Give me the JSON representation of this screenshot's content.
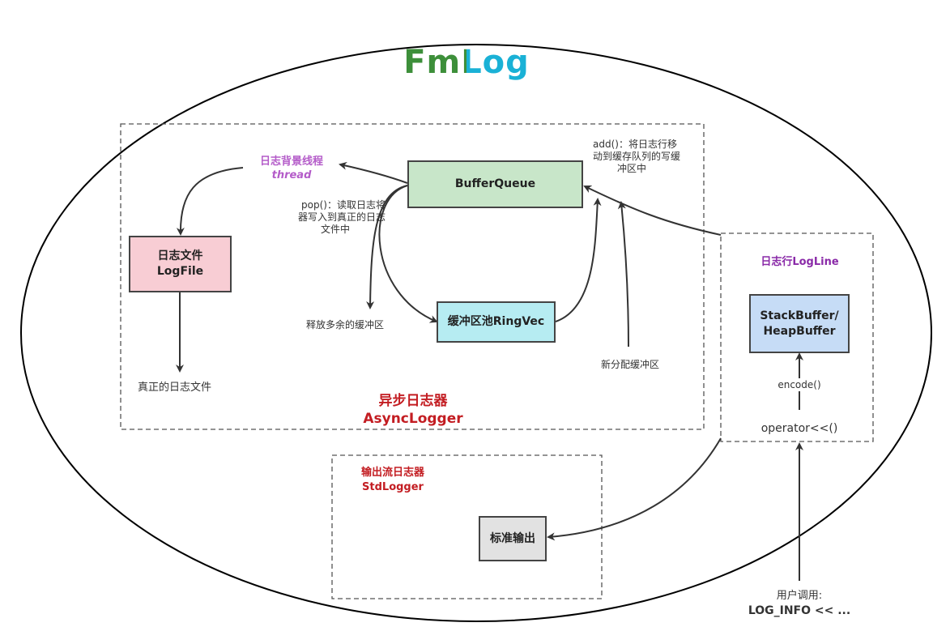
{
  "title": "FmLog",
  "title_colors": {
    "fm": "#3d8f3a",
    "log": "#1ab1d6"
  },
  "async_logger": {
    "label_cn": "异步日志器",
    "label_en": "AsyncLogger",
    "color": "#c31d22"
  },
  "std_logger": {
    "label_cn": "输出流日志器",
    "label_en": "StdLogger",
    "color": "#c31d22"
  },
  "log_line": {
    "label": "日志行LogLine",
    "color": "#8a2aa8"
  },
  "thread": {
    "label_cn": "日志背景线程",
    "label_en": "thread",
    "color": "#b45cc9"
  },
  "boxes": {
    "buffer_queue": {
      "label": "BufferQueue",
      "fill": "#c8e6c9"
    },
    "log_file": {
      "label_cn": "日志文件",
      "label_en": "LogFile",
      "fill": "#f8cdd4"
    },
    "ring_vec": {
      "label": "缓冲区池RingVec",
      "fill": "#b6ecf2"
    },
    "stack_buffer": {
      "label_a": "StackBuffer/",
      "label_b": "HeapBuffer",
      "fill": "#c6dcf6"
    },
    "std_output": {
      "label": "标准输出",
      "fill": "#e2e2e2"
    }
  },
  "annotations": {
    "pop_a": "pop()：读取日志将",
    "pop_b": "器写入到真正的日志",
    "pop_c": "文件中",
    "add_a": "add()：将日志行移",
    "add_b": "动到缓存队列的写缓",
    "add_c": "冲区中",
    "release": "释放多余的缓冲区",
    "new_alloc": "新分配缓冲区",
    "real_file": "真正的日志文件",
    "encode": "encode()",
    "operator": "operator<<()",
    "user_call": "用户调用:",
    "log_info": "LOG_INFO << ..."
  }
}
